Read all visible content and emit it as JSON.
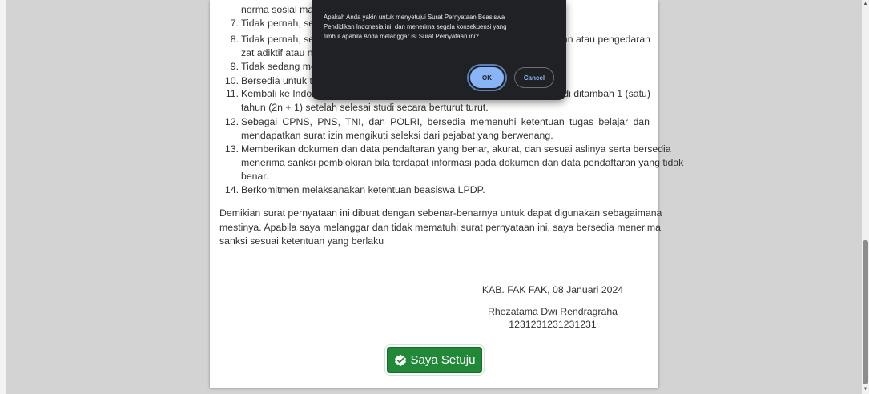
{
  "statement": {
    "items": [
      {
        "num": "",
        "lines": [
          "norma sosial mas"
        ]
      },
      {
        "num": "7.",
        "lines": [
          "Tidak pernah, sed"
        ]
      },
      {
        "num": "8.",
        "lines": [
          "Tidak pernah, sed",
          "zat adiktif atau na"
        ],
        "right": "an atau pengedaran"
      },
      {
        "num": "9.",
        "lines": [
          "Tidak sedang mer"
        ]
      },
      {
        "num": "10.",
        "lines": [
          "Bersedia untuk tid"
        ]
      },
      {
        "num": "11.",
        "lines": [
          "Kembali ke Indone",
          "tahun (2n + 1) setelah selesai studi secara berturut turut."
        ],
        "right": "udi ditambah 1 (satu)"
      },
      {
        "num": "12.",
        "lines": [
          "Sebagai CPNS, PNS, TNI, dan POLRI, bersedia memenuhi ketentuan tugas belajar dan",
          "mendapatkan surat izin mengikuti seleksi dari pejabat yang berwenang."
        ]
      },
      {
        "num": "13.",
        "lines": [
          "Memberikan dokumen dan data pendaftaran yang benar, akurat, dan sesuai aslinya serta bersedia",
          "menerima sanksi pemblokiran bila terdapat informasi pada dokumen dan data pendaftaran yang tidak",
          "benar."
        ]
      },
      {
        "num": "14.",
        "lines": [
          "Berkomitmen melaksanakan ketentuan beasiswa LPDP."
        ]
      }
    ],
    "closing_lines": [
      "Demikian surat pernyataan ini dibuat dengan sebenar-benarnya untuk dapat digunakan sebagaimana",
      "mestinya. Apabila saya melanggar dan tidak mematuhi surat pernyataan ini, saya bersedia menerima",
      "sanksi sesuai ketentuan yang berlaku"
    ],
    "place_date": "KAB. FAK FAK, 08 Januari 2024",
    "signer_name": "Rhezatama Dwi Rendragraha",
    "signer_id": "1231231231231231"
  },
  "agree_button": {
    "label": "Saya Setuju",
    "icon": "check-badge-icon",
    "color": "#218838"
  },
  "dialog": {
    "message_lines": [
      "Apakah Anda yakin untuk menyetujui Surat Pernyataan Beasiswa",
      "Pendidikan Indonesia ini, dan menerima segala konsekuensi yang",
      "timbul apabila Anda melanggar isi Surat Pernyataan ini?"
    ],
    "ok_label": "OK",
    "cancel_label": "Cancel",
    "accent": "#8ab4f8"
  }
}
